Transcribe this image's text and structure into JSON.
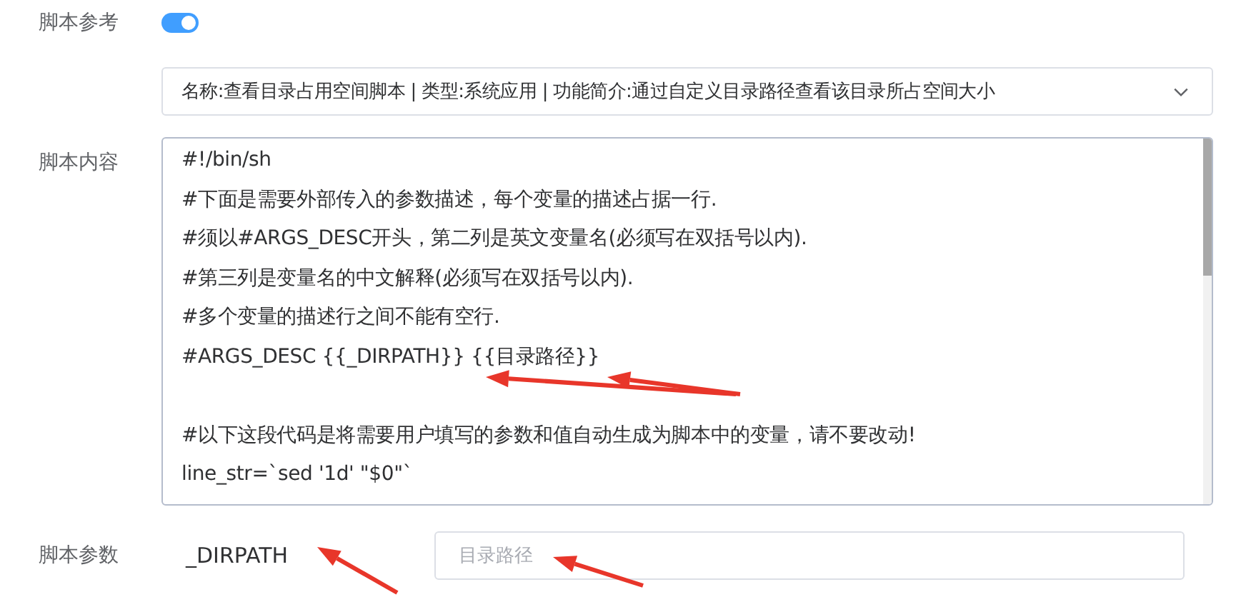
{
  "script_reference": {
    "label": "脚本参考",
    "on": true,
    "selection": "名称:查看目录占用空间脚本 | 类型:系统应用 | 功能简介:通过自定义目录路径查看该目录所占空间大小"
  },
  "script_content": {
    "label": "脚本内容",
    "value": "#!/bin/sh\n#下面是需要外部传入的参数描述，每个变量的描述占据一行.\n#须以#ARGS_DESC开头，第二列是英文变量名(必须写在双括号以内).\n#第三列是变量名的中文解释(必须写在双括号以内).\n#多个变量的描述行之间不能有空行.\n#ARGS_DESC {{_DIRPATH}} {{目录路径}}\n\n#以下这段代码是将需要用户填写的参数和值自动生成为脚本中的变量，请不要改动!\nline_str=`sed '1d' \"$0\"`"
  },
  "script_params": {
    "label": "脚本参数",
    "params": [
      {
        "name": "_DIRPATH",
        "placeholder": "目录路径"
      }
    ]
  }
}
